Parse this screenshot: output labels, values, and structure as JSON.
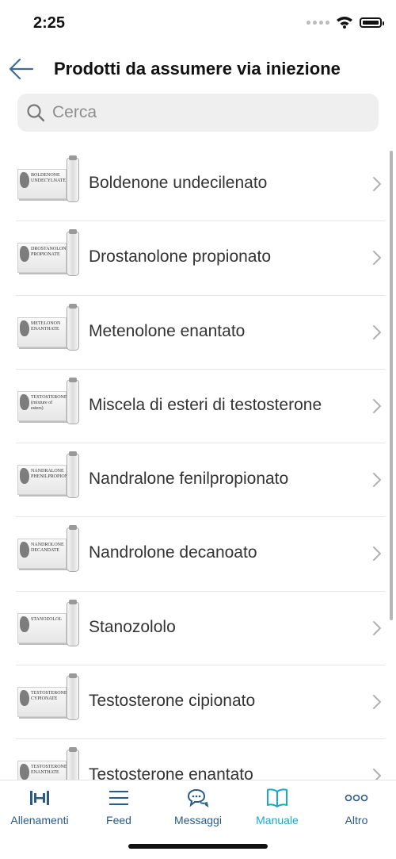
{
  "status": {
    "time": "2:25"
  },
  "header": {
    "title": "Prodotti da assumere via iniezione"
  },
  "search": {
    "placeholder": "Cerca"
  },
  "items": [
    {
      "label": "Boldenone undecilenato",
      "box_text": "BOLDENONE UNDECYLNATE"
    },
    {
      "label": "Drostanolone propionato",
      "box_text": "DROSTANOLONE PROPIONATE"
    },
    {
      "label": "Metenolone enantato",
      "box_text": "METELONON ENANTHATE"
    },
    {
      "label": "Miscela di esteri di testosterone",
      "box_text": "TESTOSTERONE (mixture of esters)"
    },
    {
      "label": "Nandralone fenilpropionato",
      "box_text": "NANDRALONE PHENILPROPIONATE"
    },
    {
      "label": "Nandrolone decanoato",
      "box_text": "NANDROLONE DECANDATE"
    },
    {
      "label": "Stanozololo",
      "box_text": "STANOZOLOL"
    },
    {
      "label": "Testosterone cipionato",
      "box_text": "TESTOSTERONE CYPIONATE"
    },
    {
      "label": "Testosterone enantato",
      "box_text": "TESTOSTERONE ENANTHATE"
    }
  ],
  "tabs": [
    {
      "label": "Allenamenti",
      "icon": "dumbbell-icon"
    },
    {
      "label": "Feed",
      "icon": "menu-icon"
    },
    {
      "label": "Messaggi",
      "icon": "chat-icon"
    },
    {
      "label": "Manuale",
      "icon": "book-icon",
      "active": true
    },
    {
      "label": "Altro",
      "icon": "more-icon"
    }
  ],
  "colors": {
    "tab_active": "#16a9c7",
    "tab_inactive": "#2a5a86",
    "back_arrow": "#3a6e96"
  }
}
